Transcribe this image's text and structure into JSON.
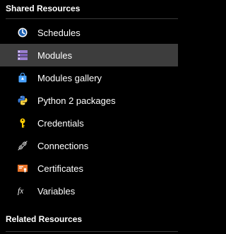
{
  "shared_resources": {
    "header": "Shared Resources",
    "items": [
      {
        "label": "Schedules",
        "icon": "clock-icon",
        "selected": false
      },
      {
        "label": "Modules",
        "icon": "modules-icon",
        "selected": true
      },
      {
        "label": "Modules gallery",
        "icon": "gallery-bag-icon",
        "selected": false
      },
      {
        "label": "Python 2 packages",
        "icon": "python-icon",
        "selected": false
      },
      {
        "label": "Credentials",
        "icon": "key-icon",
        "selected": false
      },
      {
        "label": "Connections",
        "icon": "plug-icon",
        "selected": false
      },
      {
        "label": "Certificates",
        "icon": "certificate-icon",
        "selected": false
      },
      {
        "label": "Variables",
        "icon": "fx-icon",
        "selected": false
      }
    ]
  },
  "related_resources": {
    "header": "Related Resources"
  },
  "colors": {
    "background": "#000000",
    "selected": "#3d3d3d",
    "accent_blue": "#4aa3ff",
    "modules_purple": "#8a6fbf",
    "key_yellow": "#ffcc00",
    "cert_orange": "#e8742a"
  }
}
